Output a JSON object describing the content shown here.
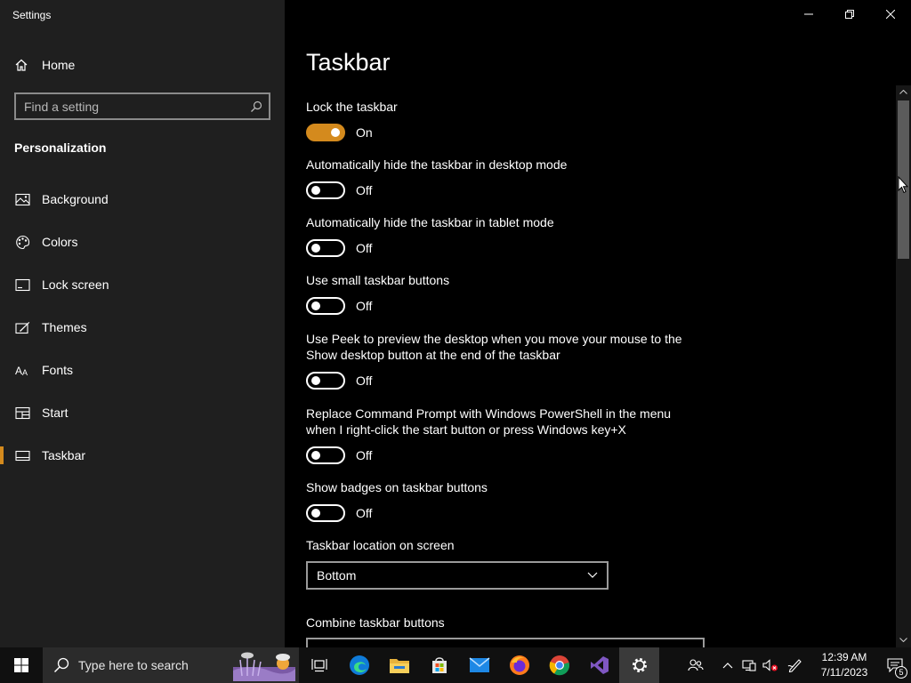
{
  "window": {
    "title": "Settings"
  },
  "sidebar": {
    "home_label": "Home",
    "search_placeholder": "Find a setting",
    "section_title": "Personalization",
    "items": [
      {
        "label": "Background",
        "icon": "picture-icon"
      },
      {
        "label": "Colors",
        "icon": "palette-icon"
      },
      {
        "label": "Lock screen",
        "icon": "lock-screen-icon"
      },
      {
        "label": "Themes",
        "icon": "themes-icon"
      },
      {
        "label": "Fonts",
        "icon": "fonts-icon"
      },
      {
        "label": "Start",
        "icon": "start-icon"
      },
      {
        "label": "Taskbar",
        "icon": "taskbar-icon",
        "active": true
      }
    ]
  },
  "main": {
    "title": "Taskbar",
    "settings": [
      {
        "label": "Lock the taskbar",
        "state": "On"
      },
      {
        "label": "Automatically hide the taskbar in desktop mode",
        "state": "Off"
      },
      {
        "label": "Automatically hide the taskbar in tablet mode",
        "state": "Off"
      },
      {
        "label": "Use small taskbar buttons",
        "state": "Off"
      },
      {
        "label": "Use Peek to preview the desktop when you move your mouse to the Show desktop button at the end of the taskbar",
        "state": "Off"
      },
      {
        "label": "Replace Command Prompt with Windows PowerShell in the menu when I right-click the start button or press Windows key+X",
        "state": "Off"
      },
      {
        "label": "Show badges on taskbar buttons",
        "state": "Off"
      }
    ],
    "location": {
      "label": "Taskbar location on screen",
      "value": "Bottom"
    },
    "combine": {
      "label": "Combine taskbar buttons"
    }
  },
  "taskbar": {
    "search_text": "Type here to search",
    "time": "12:39 AM",
    "date": "7/11/2023",
    "notification_count": "5"
  },
  "colors": {
    "accent": "#d48a1d",
    "sidebar_bg": "#1f1f1f",
    "content_bg": "#000000"
  }
}
